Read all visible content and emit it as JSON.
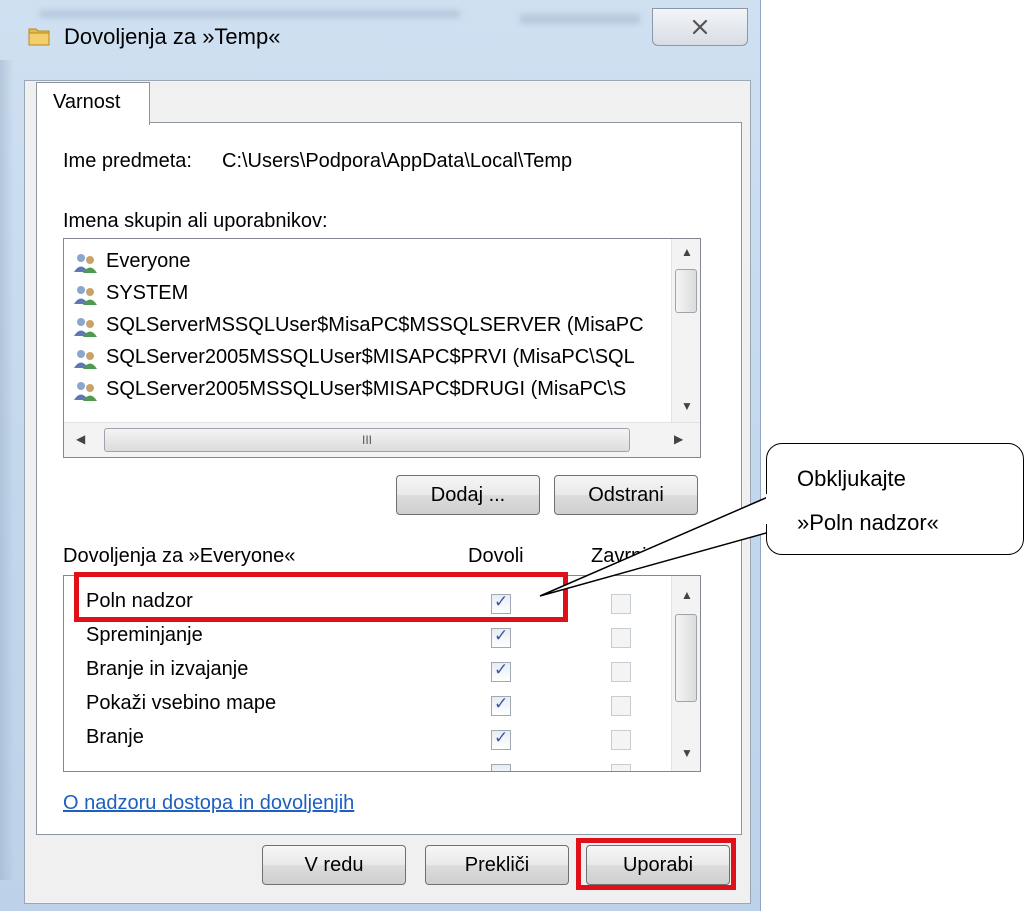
{
  "window": {
    "title": "Dovoljenja za »Temp«",
    "close_label": "✕"
  },
  "tabs": [
    {
      "label": "Varnost"
    }
  ],
  "security": {
    "object_label": "Ime predmeta:",
    "object_path": "C:\\Users\\Podpora\\AppData\\Local\\Temp",
    "groups_label": "Imena skupin ali uporabnikov:",
    "users": [
      "Everyone",
      "SYSTEM",
      "SQLServerMSSQLUser$MisaPC$MSSQLSERVER (MisaPC",
      "SQLServer2005MSSQLUser$MISAPC$PRVI (MisaPC\\SQL",
      "SQLServer2005MSSQLUser$MISAPC$DRUGI (MisaPC\\S"
    ],
    "hscroll_grip": "III",
    "add_button": "Dodaj ...",
    "remove_button": "Odstrani",
    "permissions_for": "Dovoljenja za »Everyone«",
    "col_allow": "Dovoli",
    "col_deny": "Zavrni",
    "permissions": [
      {
        "name": "Poln nadzor",
        "allow": true,
        "deny": false
      },
      {
        "name": "Spreminjanje",
        "allow": true,
        "deny": false
      },
      {
        "name": "Branje in izvajanje",
        "allow": true,
        "deny": false
      },
      {
        "name": "Pokaži vsebino mape",
        "allow": true,
        "deny": false
      },
      {
        "name": "Branje",
        "allow": true,
        "deny": false
      }
    ],
    "help_link": "O nadzoru dostopa in dovoljenjih"
  },
  "footer": {
    "ok_button": "V redu",
    "cancel_button": "Prekliči",
    "apply_button": "Uporabi"
  },
  "callout": {
    "line1": "Obkljukajte",
    "line2": "»Poln nadzor«"
  },
  "icons": {
    "title": "folder-icon",
    "users": "user-group-icon",
    "close": "close-icon"
  },
  "colors": {
    "highlight": "#e0101a",
    "link": "#1f5fbf",
    "check": "#3b5aa6"
  }
}
